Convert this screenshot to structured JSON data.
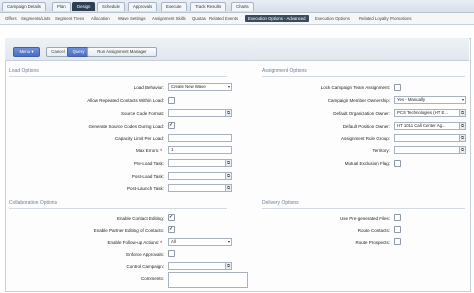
{
  "tabs": [
    "Campaign Details",
    "Plan",
    "Design",
    "Schedule",
    "Approvals",
    "Execute",
    "Track Results",
    "Charts"
  ],
  "active_tab": "Design",
  "subtabs": [
    "Offers",
    "Segments/Lists",
    "Segment Trees",
    "Allocation",
    "Wave Settings",
    "Assignment Skills",
    "Quotas",
    "Related Events",
    "Execution Options - Advanced",
    "Execution Options",
    "Related Loyalty Promotions"
  ],
  "active_subtab": "Execution Options - Advanced",
  "toolbar": {
    "menu": "Menu ▾",
    "cancel": "Cancel",
    "query": "Query",
    "run": "Run Assignment Manager"
  },
  "load_options": {
    "title": "Load Options",
    "load_behavior": {
      "label": "Load Behavior:",
      "value": "Create New Wave"
    },
    "allow_repeated": {
      "label": "Allow Repeated Contacts Within Load:",
      "checked": false
    },
    "source_code_format": {
      "label": "Source Code Format:",
      "value": ""
    },
    "generate_source_codes": {
      "label": "Generate Source Codes During Load:",
      "checked": true
    },
    "capacity_limit": {
      "label": "Capacity Limit Per Load:",
      "value": ""
    },
    "max_errors": {
      "label": "Max Errors:",
      "value": "1"
    },
    "pre_load_task": {
      "label": "Pre-Load Task:",
      "value": ""
    },
    "post_load_task": {
      "label": "Post-Load Task:",
      "value": ""
    },
    "post_launch_task": {
      "label": "Post-Launch Task:",
      "value": ""
    }
  },
  "assignment_options": {
    "title": "Assignment Options",
    "lock_team": {
      "label": "Lock Campaign Team Assignment:",
      "checked": false
    },
    "member_ownership": {
      "label": "Campaign Member Ownership:",
      "value": "Yes - Manually"
    },
    "default_org_owner": {
      "label": "Default Organization Owner:",
      "value": "PCS Technologies (HT E..."
    },
    "default_position_owner": {
      "label": "Default Position Owner:",
      "value": "HT 1011 Call Center Ag..."
    },
    "assignment_rule_group": {
      "label": "Assignment Rule Group:",
      "value": ""
    },
    "territory": {
      "label": "Territory:",
      "value": ""
    },
    "mutual_exclusion": {
      "label": "Mutual Exclusion Flag:",
      "checked": false
    }
  },
  "collaboration_options": {
    "title": "Collaboration Options",
    "enable_contact_editing": {
      "label": "Enable Contact Editing:",
      "checked": true
    },
    "enable_partner_editing": {
      "label": "Enable Partner Editing of Contacts:",
      "checked": true
    },
    "enable_follow_up": {
      "label": "Enable Follow-up Actions:",
      "value": "All"
    },
    "enforce_approvals": {
      "label": "Enforce Approvals:",
      "checked": false
    },
    "control_campaign": {
      "label": "Control Campaign:",
      "value": ""
    },
    "comments": {
      "label": "Comments:",
      "value": ""
    }
  },
  "delivery_options": {
    "title": "Delivery Options",
    "use_pregenerated": {
      "label": "Use Pre-generated Files:",
      "checked": false
    },
    "route_contacts": {
      "label": "Route Contacts:",
      "checked": false
    },
    "route_prospects": {
      "label": "Route Prospects:",
      "checked": false
    }
  }
}
